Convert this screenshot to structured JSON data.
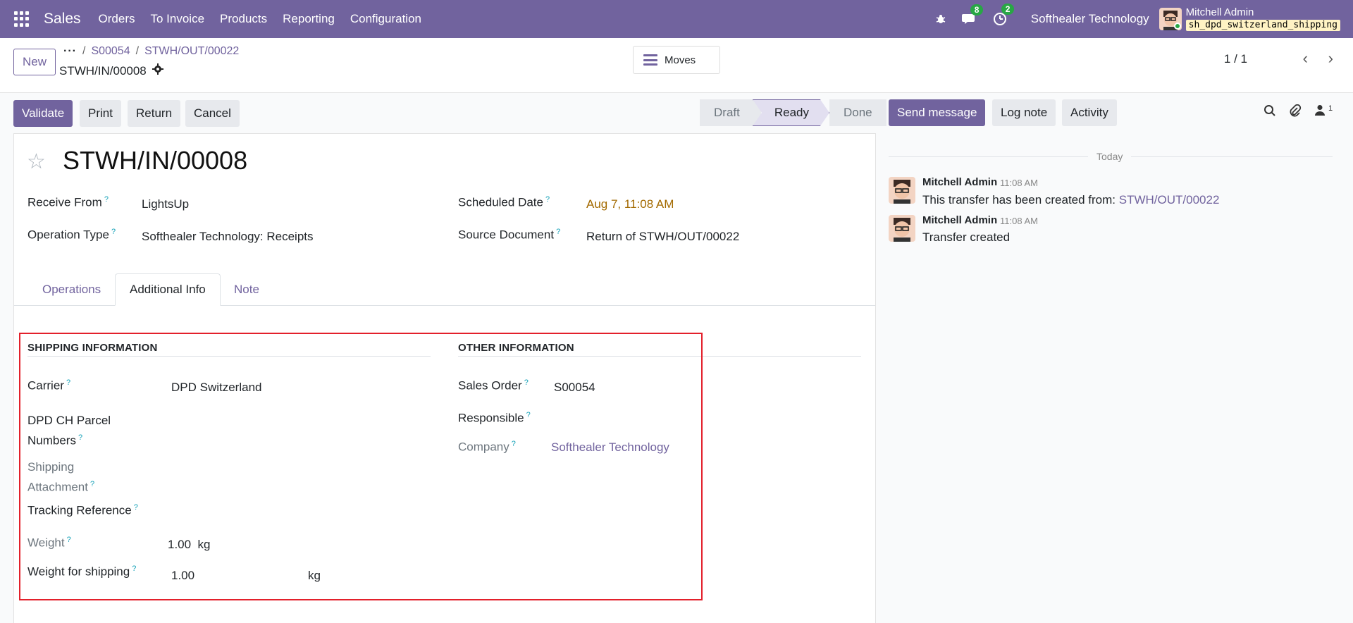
{
  "navbar": {
    "app_name": "Sales",
    "menu": [
      "Orders",
      "To Invoice",
      "Products",
      "Reporting",
      "Configuration"
    ],
    "messages_count": "8",
    "activities_count": "2",
    "company": "Softhealer Technology",
    "user_name": "Mitchell Admin",
    "database": "sh_dpd_switzerland_shipping"
  },
  "control": {
    "new_label": "New",
    "breadcrumb": [
      "S00054",
      "STWH/OUT/00022"
    ],
    "record": "STWH/IN/00008",
    "moves_label": "Moves",
    "pager": "1 / 1"
  },
  "actions": {
    "validate": "Validate",
    "print": "Print",
    "return": "Return",
    "cancel": "Cancel"
  },
  "status": {
    "stages": [
      "Draft",
      "Ready",
      "Done"
    ],
    "active": "Ready"
  },
  "form": {
    "title": "STWH/IN/00008",
    "receive_from_label": "Receive From",
    "receive_from": "LightsUp",
    "operation_type_label": "Operation Type",
    "operation_type": "Softhealer Technology: Receipts",
    "scheduled_date_label": "Scheduled Date",
    "scheduled_date": "Aug 7, 11:08 AM",
    "source_document_label": "Source Document",
    "source_document": "Return of STWH/OUT/00022"
  },
  "tabs": [
    "Operations",
    "Additional Info",
    "Note"
  ],
  "shipping": {
    "heading": "SHIPPING INFORMATION",
    "carrier_label": "Carrier",
    "carrier": "DPD Switzerland",
    "parcel_label_1": "DPD CH Parcel",
    "parcel_label_2": "Numbers",
    "attachment_label_1": "Shipping",
    "attachment_label_2": "Attachment",
    "tracking_label": "Tracking Reference",
    "weight_label": "Weight",
    "weight": "1.00",
    "weight_unit": "kg",
    "weight_shipping_label": "Weight for shipping",
    "weight_shipping": "1.00",
    "weight_shipping_unit": "kg"
  },
  "other": {
    "heading": "OTHER INFORMATION",
    "sales_order_label": "Sales Order",
    "sales_order": "S00054",
    "responsible_label": "Responsible",
    "company_label": "Company",
    "company": "Softhealer Technology"
  },
  "chatter": {
    "send_message": "Send message",
    "log_note": "Log note",
    "activity": "Activity",
    "followers": "1",
    "today": "Today",
    "messages": [
      {
        "author": "Mitchell Admin",
        "time": "11:08 AM",
        "text": "This transfer has been created from: ",
        "link": "STWH/OUT/00022"
      },
      {
        "author": "Mitchell Admin",
        "time": "11:08 AM",
        "text": "Transfer created"
      }
    ]
  },
  "icons": {
    "apps": "apps-grid-icon",
    "bug": "bug-icon",
    "chat": "chat-icon",
    "clock": "clock-icon",
    "gear": "gear-icon",
    "search": "search-icon",
    "paperclip": "paperclip-icon",
    "user": "user-icon"
  },
  "colors": {
    "brand": "#71639e",
    "highlight": "#e3202b",
    "badge": "#28a745"
  }
}
